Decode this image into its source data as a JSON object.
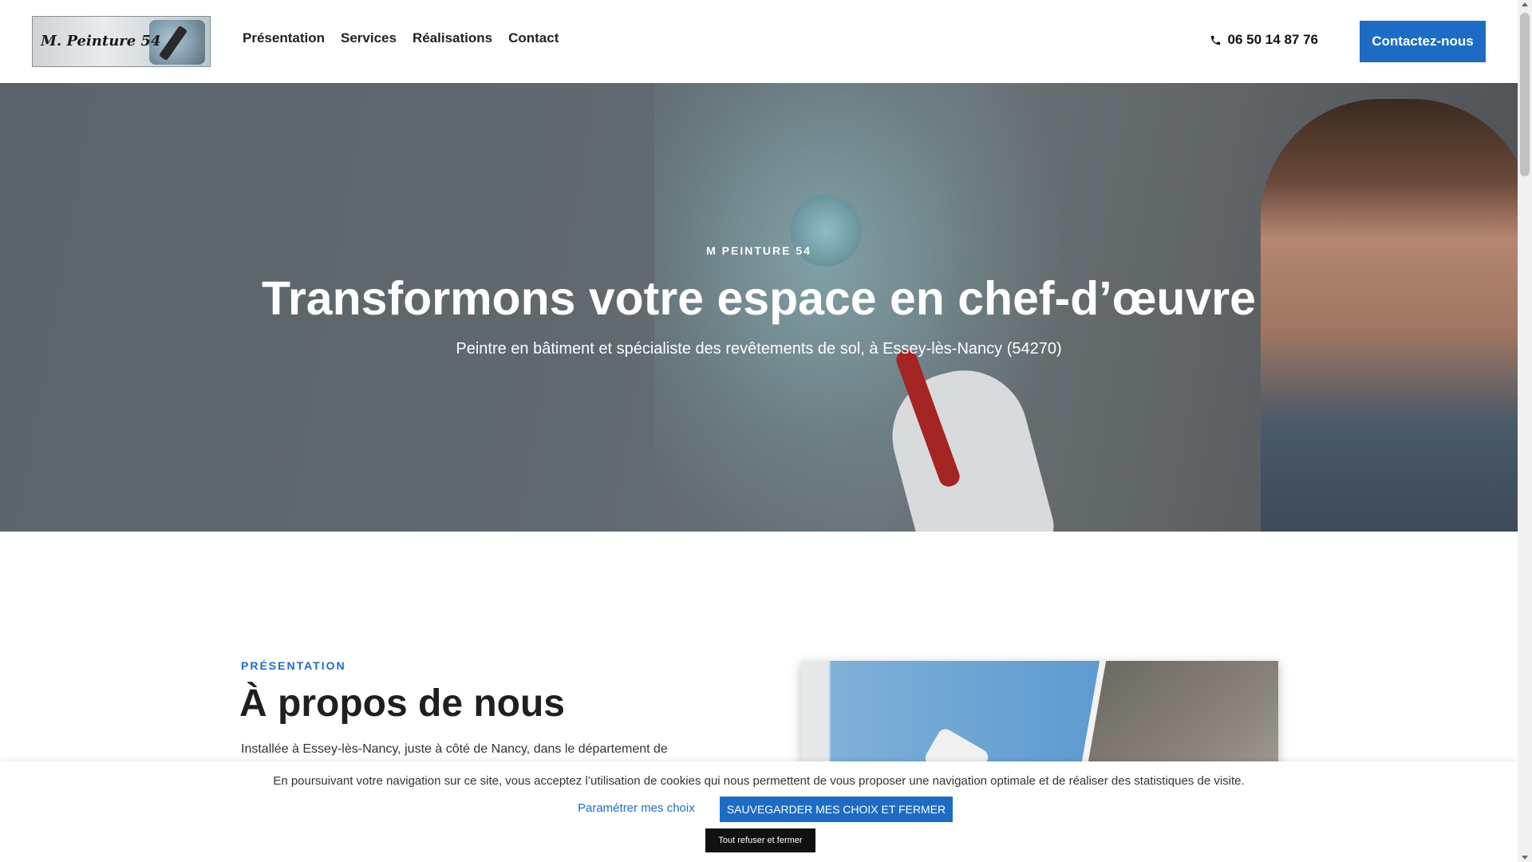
{
  "header": {
    "logo_text": "M. Peinture 54",
    "nav": [
      {
        "label": "Présentation"
      },
      {
        "label": "Services"
      },
      {
        "label": "Réalisations"
      },
      {
        "label": "Contact"
      }
    ],
    "phone": "06 50 14 87 76",
    "cta_label": "Contactez-nous"
  },
  "hero": {
    "eyebrow": "M PEINTURE 54",
    "title": "Transformons votre espace en chef-d’œuvre",
    "subtitle": "Peintre en bâtiment et spécialiste des revêtements de sol, à Essey-lès-Nancy (54270)"
  },
  "about": {
    "eyebrow": "PRÉSENTATION",
    "title": "À propos de nous",
    "text": "Installée à Essey-lès-Nancy, juste à côté de Nancy, dans le département de"
  },
  "cookie": {
    "text": "En poursuivant votre navigation sur ce site, vous acceptez l’utilisation de cookies qui nous permettent de vous proposer une navigation optimale et de réaliser des statistiques de visite.",
    "settings_label": "Paramétrer mes choix",
    "save_label": "SAUVEGARDER MES CHOIX ET FERMER",
    "refuse_label": "Tout refuser et fermer"
  },
  "colors": {
    "accent": "#1c6cc6",
    "hero_overlay": "#5a6469",
    "refuse_button": "#111111"
  },
  "icons": {
    "phone": "phone-icon"
  }
}
